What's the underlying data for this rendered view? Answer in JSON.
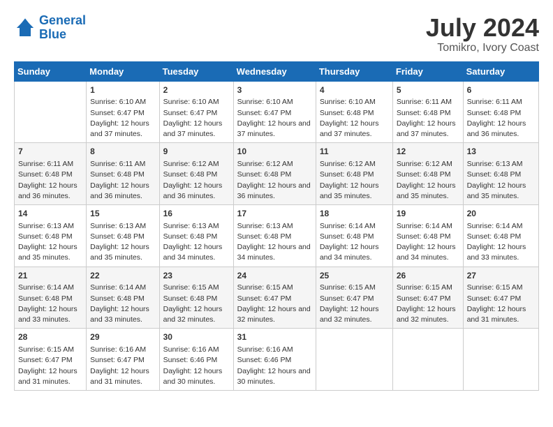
{
  "header": {
    "logo_line1": "General",
    "logo_line2": "Blue",
    "month": "July 2024",
    "location": "Tomikro, Ivory Coast"
  },
  "days_of_week": [
    "Sunday",
    "Monday",
    "Tuesday",
    "Wednesday",
    "Thursday",
    "Friday",
    "Saturday"
  ],
  "weeks": [
    [
      {
        "num": "",
        "sunrise": "",
        "sunset": "",
        "daylight": ""
      },
      {
        "num": "1",
        "sunrise": "Sunrise: 6:10 AM",
        "sunset": "Sunset: 6:47 PM",
        "daylight": "Daylight: 12 hours and 37 minutes."
      },
      {
        "num": "2",
        "sunrise": "Sunrise: 6:10 AM",
        "sunset": "Sunset: 6:47 PM",
        "daylight": "Daylight: 12 hours and 37 minutes."
      },
      {
        "num": "3",
        "sunrise": "Sunrise: 6:10 AM",
        "sunset": "Sunset: 6:47 PM",
        "daylight": "Daylight: 12 hours and 37 minutes."
      },
      {
        "num": "4",
        "sunrise": "Sunrise: 6:10 AM",
        "sunset": "Sunset: 6:48 PM",
        "daylight": "Daylight: 12 hours and 37 minutes."
      },
      {
        "num": "5",
        "sunrise": "Sunrise: 6:11 AM",
        "sunset": "Sunset: 6:48 PM",
        "daylight": "Daylight: 12 hours and 37 minutes."
      },
      {
        "num": "6",
        "sunrise": "Sunrise: 6:11 AM",
        "sunset": "Sunset: 6:48 PM",
        "daylight": "Daylight: 12 hours and 36 minutes."
      }
    ],
    [
      {
        "num": "7",
        "sunrise": "Sunrise: 6:11 AM",
        "sunset": "Sunset: 6:48 PM",
        "daylight": "Daylight: 12 hours and 36 minutes."
      },
      {
        "num": "8",
        "sunrise": "Sunrise: 6:11 AM",
        "sunset": "Sunset: 6:48 PM",
        "daylight": "Daylight: 12 hours and 36 minutes."
      },
      {
        "num": "9",
        "sunrise": "Sunrise: 6:12 AM",
        "sunset": "Sunset: 6:48 PM",
        "daylight": "Daylight: 12 hours and 36 minutes."
      },
      {
        "num": "10",
        "sunrise": "Sunrise: 6:12 AM",
        "sunset": "Sunset: 6:48 PM",
        "daylight": "Daylight: 12 hours and 36 minutes."
      },
      {
        "num": "11",
        "sunrise": "Sunrise: 6:12 AM",
        "sunset": "Sunset: 6:48 PM",
        "daylight": "Daylight: 12 hours and 35 minutes."
      },
      {
        "num": "12",
        "sunrise": "Sunrise: 6:12 AM",
        "sunset": "Sunset: 6:48 PM",
        "daylight": "Daylight: 12 hours and 35 minutes."
      },
      {
        "num": "13",
        "sunrise": "Sunrise: 6:13 AM",
        "sunset": "Sunset: 6:48 PM",
        "daylight": "Daylight: 12 hours and 35 minutes."
      }
    ],
    [
      {
        "num": "14",
        "sunrise": "Sunrise: 6:13 AM",
        "sunset": "Sunset: 6:48 PM",
        "daylight": "Daylight: 12 hours and 35 minutes."
      },
      {
        "num": "15",
        "sunrise": "Sunrise: 6:13 AM",
        "sunset": "Sunset: 6:48 PM",
        "daylight": "Daylight: 12 hours and 35 minutes."
      },
      {
        "num": "16",
        "sunrise": "Sunrise: 6:13 AM",
        "sunset": "Sunset: 6:48 PM",
        "daylight": "Daylight: 12 hours and 34 minutes."
      },
      {
        "num": "17",
        "sunrise": "Sunrise: 6:13 AM",
        "sunset": "Sunset: 6:48 PM",
        "daylight": "Daylight: 12 hours and 34 minutes."
      },
      {
        "num": "18",
        "sunrise": "Sunrise: 6:14 AM",
        "sunset": "Sunset: 6:48 PM",
        "daylight": "Daylight: 12 hours and 34 minutes."
      },
      {
        "num": "19",
        "sunrise": "Sunrise: 6:14 AM",
        "sunset": "Sunset: 6:48 PM",
        "daylight": "Daylight: 12 hours and 34 minutes."
      },
      {
        "num": "20",
        "sunrise": "Sunrise: 6:14 AM",
        "sunset": "Sunset: 6:48 PM",
        "daylight": "Daylight: 12 hours and 33 minutes."
      }
    ],
    [
      {
        "num": "21",
        "sunrise": "Sunrise: 6:14 AM",
        "sunset": "Sunset: 6:48 PM",
        "daylight": "Daylight: 12 hours and 33 minutes."
      },
      {
        "num": "22",
        "sunrise": "Sunrise: 6:14 AM",
        "sunset": "Sunset: 6:48 PM",
        "daylight": "Daylight: 12 hours and 33 minutes."
      },
      {
        "num": "23",
        "sunrise": "Sunrise: 6:15 AM",
        "sunset": "Sunset: 6:48 PM",
        "daylight": "Daylight: 12 hours and 32 minutes."
      },
      {
        "num": "24",
        "sunrise": "Sunrise: 6:15 AM",
        "sunset": "Sunset: 6:47 PM",
        "daylight": "Daylight: 12 hours and 32 minutes."
      },
      {
        "num": "25",
        "sunrise": "Sunrise: 6:15 AM",
        "sunset": "Sunset: 6:47 PM",
        "daylight": "Daylight: 12 hours and 32 minutes."
      },
      {
        "num": "26",
        "sunrise": "Sunrise: 6:15 AM",
        "sunset": "Sunset: 6:47 PM",
        "daylight": "Daylight: 12 hours and 32 minutes."
      },
      {
        "num": "27",
        "sunrise": "Sunrise: 6:15 AM",
        "sunset": "Sunset: 6:47 PM",
        "daylight": "Daylight: 12 hours and 31 minutes."
      }
    ],
    [
      {
        "num": "28",
        "sunrise": "Sunrise: 6:15 AM",
        "sunset": "Sunset: 6:47 PM",
        "daylight": "Daylight: 12 hours and 31 minutes."
      },
      {
        "num": "29",
        "sunrise": "Sunrise: 6:16 AM",
        "sunset": "Sunset: 6:47 PM",
        "daylight": "Daylight: 12 hours and 31 minutes."
      },
      {
        "num": "30",
        "sunrise": "Sunrise: 6:16 AM",
        "sunset": "Sunset: 6:46 PM",
        "daylight": "Daylight: 12 hours and 30 minutes."
      },
      {
        "num": "31",
        "sunrise": "Sunrise: 6:16 AM",
        "sunset": "Sunset: 6:46 PM",
        "daylight": "Daylight: 12 hours and 30 minutes."
      },
      {
        "num": "",
        "sunrise": "",
        "sunset": "",
        "daylight": ""
      },
      {
        "num": "",
        "sunrise": "",
        "sunset": "",
        "daylight": ""
      },
      {
        "num": "",
        "sunrise": "",
        "sunset": "",
        "daylight": ""
      }
    ]
  ]
}
